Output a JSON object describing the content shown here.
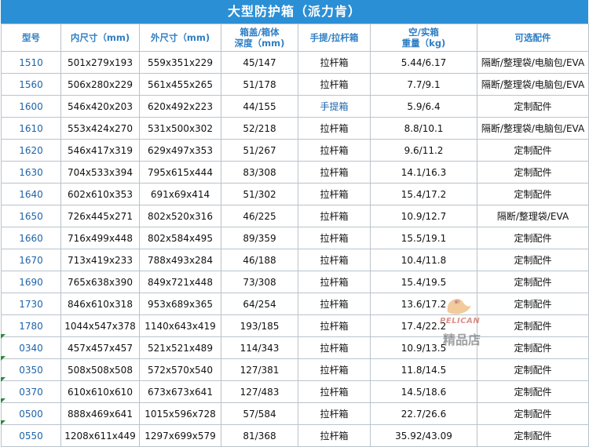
{
  "title": "大型防护箱（派力肯）",
  "headers": [
    [
      "型号"
    ],
    [
      "内尺寸（mm)"
    ],
    [
      "外尺寸（mm)"
    ],
    [
      "箱盖/箱体",
      "深度（mm)"
    ],
    [
      "手提/拉杆箱"
    ],
    [
      "空/实箱",
      "重量（kg)"
    ],
    [
      "可选配件"
    ]
  ],
  "rows": [
    {
      "model": "1510",
      "inner": "501x279x193",
      "outer": "559x351x229",
      "depth": "45/147",
      "type": "拉杆箱",
      "weight": "5.44/6.17",
      "acc": "隔断/整理袋/电脑包/EVA"
    },
    {
      "model": "1560",
      "inner": "506x280x229",
      "outer": "561x455x265",
      "depth": "51/178",
      "type": "拉杆箱",
      "weight": "7.7/9.1",
      "acc": "隔断/整理袋/电脑包/EVA"
    },
    {
      "model": "1600",
      "inner": "546x420x203",
      "outer": "620x492x223",
      "depth": "44/155",
      "type": "手提箱",
      "weight": "5.9/6.4",
      "acc": "定制配件"
    },
    {
      "model": "1610",
      "inner": "553x424x270",
      "outer": "531x500x302",
      "depth": "52/218",
      "type": "拉杆箱",
      "weight": "8.8/10.1",
      "acc": "隔断/整理袋/电脑包/EVA"
    },
    {
      "model": "1620",
      "inner": "546x417x319",
      "outer": "629x497x353",
      "depth": "51/267",
      "type": "拉杆箱",
      "weight": "9.6/11.2",
      "acc": "定制配件"
    },
    {
      "model": "1630",
      "inner": "704x533x394",
      "outer": "795x615x444",
      "depth": "83/308",
      "type": "拉杆箱",
      "weight": "14.1/16.3",
      "acc": "定制配件"
    },
    {
      "model": "1640",
      "inner": "602x610x353",
      "outer": "691x69x414",
      "depth": "51/302",
      "type": "拉杆箱",
      "weight": "15.4/17.2",
      "acc": "定制配件"
    },
    {
      "model": "1650",
      "inner": "726x445x271",
      "outer": "802x520x316",
      "depth": "46/225",
      "type": "拉杆箱",
      "weight": "10.9/12.7",
      "acc": "隔断/整理袋/EVA"
    },
    {
      "model": "1660",
      "inner": "716x499x448",
      "outer": "802x584x495",
      "depth": "89/359",
      "type": "拉杆箱",
      "weight": "15.5/19.1",
      "acc": "定制配件"
    },
    {
      "model": "1670",
      "inner": "713x419x233",
      "outer": "788x493x284",
      "depth": "46/188",
      "type": "拉杆箱",
      "weight": "10.4/11.8",
      "acc": "定制配件"
    },
    {
      "model": "1690",
      "inner": "765x638x390",
      "outer": "849x721x448",
      "depth": "73/308",
      "type": "拉杆箱",
      "weight": "15.4/19.5",
      "acc": "定制配件"
    },
    {
      "model": "1730",
      "inner": "846x610x318",
      "outer": "953x689x365",
      "depth": "64/254",
      "type": "拉杆箱",
      "weight": "13.6/17.2",
      "acc": "定制配件"
    },
    {
      "model": "1780",
      "inner": "1044x547x378",
      "outer": "1140x643x419",
      "depth": "193/185",
      "type": "拉杆箱",
      "weight": "17.4/22.2",
      "acc": "定制配件"
    },
    {
      "model": "0340",
      "inner": "457x457x457",
      "outer": "521x521x489",
      "depth": "114/343",
      "type": "拉杆箱",
      "weight": "10.9/13.5",
      "acc": "定制配件"
    },
    {
      "model": "0350",
      "inner": "508x508x508",
      "outer": "572x570x540",
      "depth": "127/381",
      "type": "拉杆箱",
      "weight": "11.8/14.5",
      "acc": "定制配件"
    },
    {
      "model": "0370",
      "inner": "610x610x610",
      "outer": "673x673x641",
      "depth": "127/483",
      "type": "拉杆箱",
      "weight": "14.5/18.6",
      "acc": "定制配件"
    },
    {
      "model": "0500",
      "inner": "888x469x641",
      "outer": "1015x596x728",
      "depth": "57/584",
      "type": "拉杆箱",
      "weight": "22.7/26.6",
      "acc": "定制配件"
    },
    {
      "model": "0550",
      "inner": "1208x611x449",
      "outer": "1297x699x579",
      "depth": "81/368",
      "type": "拉杆箱",
      "weight": "35.92/43.09",
      "acc": "定制配件"
    }
  ],
  "watermark": {
    "brand": "PELICAN",
    "shop": "精品店",
    "icon": "pelican-logo-icon"
  },
  "colors": {
    "title_bg": "#2b8fd6",
    "header_text": "#2e7ec4",
    "model_text": "#1e63a8",
    "border": "#b9c3cc"
  }
}
